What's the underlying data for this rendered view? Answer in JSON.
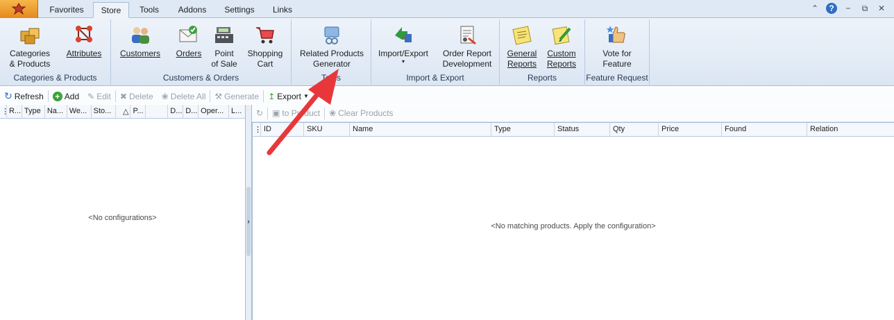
{
  "tabs": [
    "Favorites",
    "Store",
    "Tools",
    "Addons",
    "Settings",
    "Links"
  ],
  "active_tab": "Store",
  "ribbon": {
    "groups": [
      {
        "label": "Categories & Products",
        "buttons": [
          "Categories\n& Products",
          "Attributes"
        ]
      },
      {
        "label": "Customers & Orders",
        "buttons": [
          "Customers",
          "Orders",
          "Point\nof Sale",
          "Shopping\nCart"
        ]
      },
      {
        "label": "Tools",
        "buttons": [
          "Related Products\nGenerator"
        ]
      },
      {
        "label": "Import & Export",
        "buttons": [
          "Import/Export",
          "Order Report\nDevelopment"
        ]
      },
      {
        "label": "Reports",
        "buttons": [
          "General\nReports",
          "Custom\nReports"
        ]
      },
      {
        "label": "Feature Request",
        "buttons": [
          "Vote for\nFeature"
        ]
      }
    ]
  },
  "toolbar": {
    "refresh": "Refresh",
    "add": "Add",
    "edit": "Edit",
    "delete": "Delete",
    "delete_all": "Delete All",
    "generate": "Generate",
    "export": "Export"
  },
  "left_grid": {
    "columns": [
      "R...",
      "Type",
      "Na...",
      "We...",
      "Sto...",
      "",
      "P...",
      "",
      "D...",
      "D...",
      "Oper...",
      "L..."
    ],
    "empty_message": "<No configurations>"
  },
  "right_toolbar": {
    "to_product": "to Product",
    "clear_products": "Clear Products"
  },
  "right_grid": {
    "columns": [
      "ID",
      "SKU",
      "Name",
      "Type",
      "Status",
      "Qty",
      "Price",
      "Found",
      "Relation"
    ],
    "empty_message": "<No matching products. Apply the configuration>"
  },
  "colors": {
    "ribbon_bg": "#dbe6f3",
    "accent": "#2f6fc3",
    "arrow": "#e8373a"
  }
}
